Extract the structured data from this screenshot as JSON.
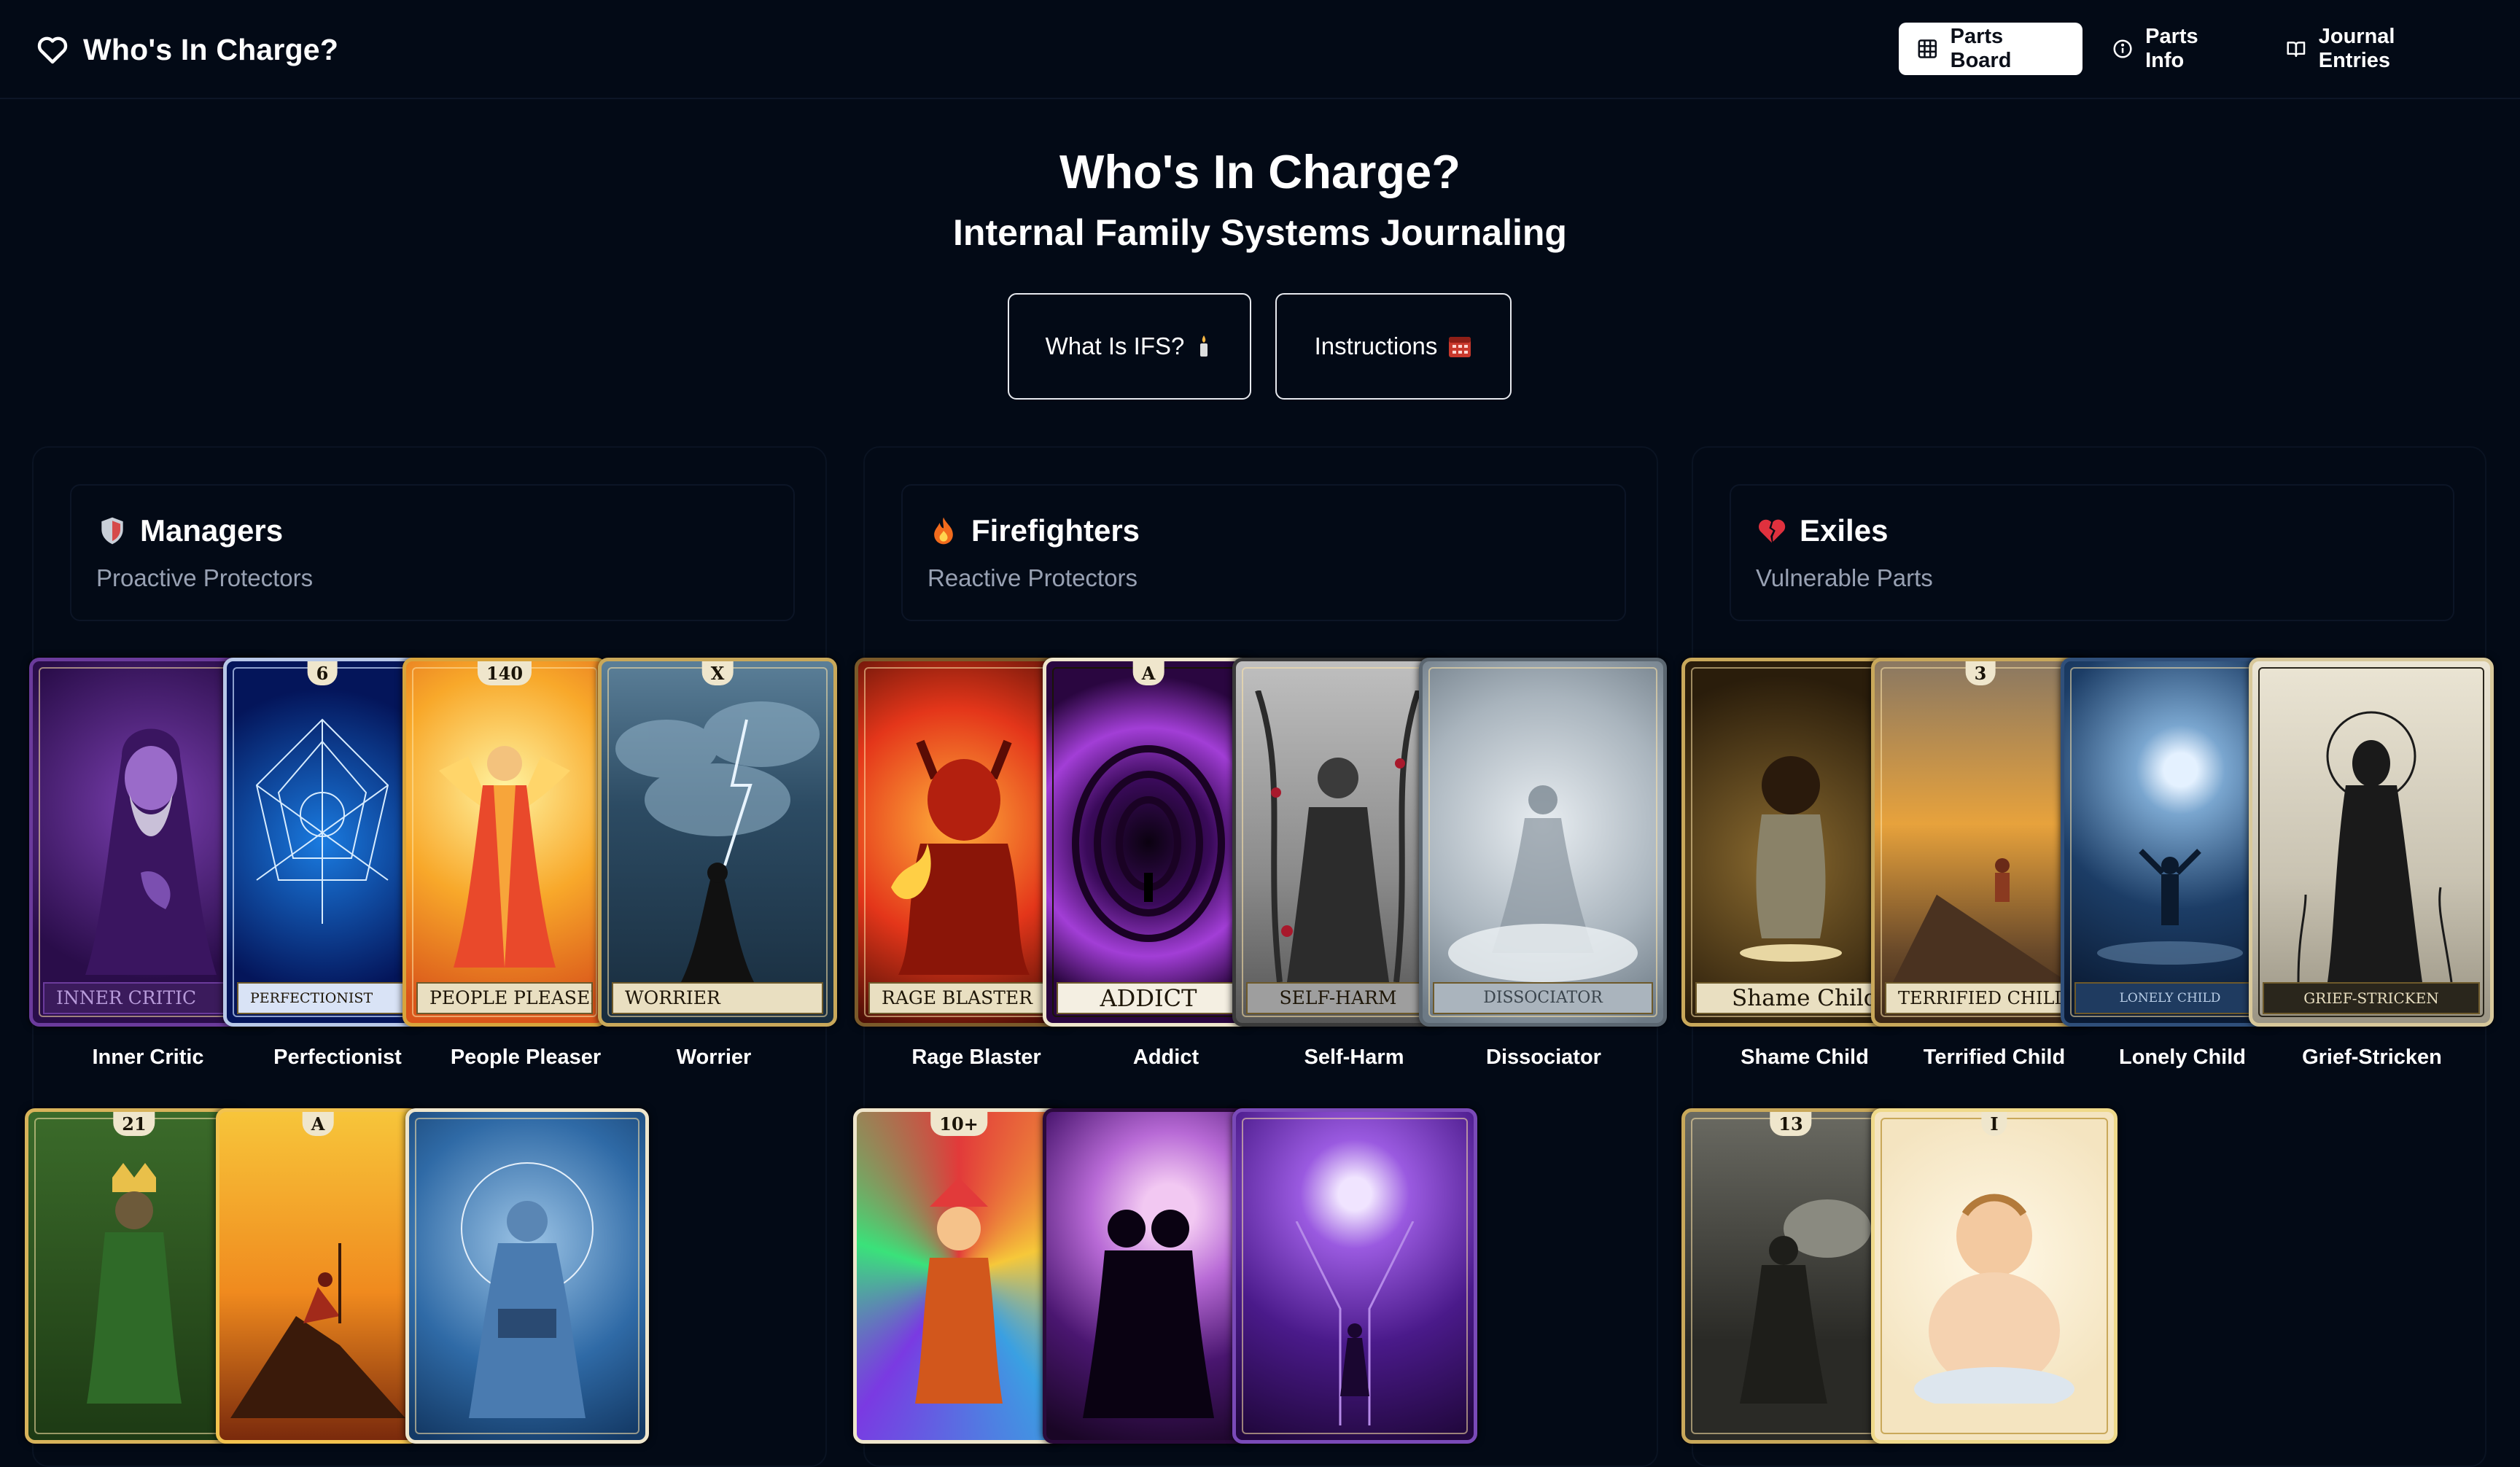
{
  "app": {
    "title": "Who's In Charge?"
  },
  "nav": {
    "parts_board": "Parts Board",
    "parts_info": "Parts Info",
    "journal_entries": "Journal Entries"
  },
  "hero": {
    "title": "Who's In Charge?",
    "subtitle": "Internal Family Systems Journaling",
    "what_is_ifs": "What Is IFS?",
    "instructions": "Instructions"
  },
  "columns": [
    {
      "emoji": "shield",
      "title": "Managers",
      "subtitle": "Proactive Protectors",
      "cards": [
        {
          "label": "Inner Critic",
          "plate": "INNER CRITIC"
        },
        {
          "label": "Perfectionist",
          "plate": "PERFECTIONIST",
          "number": "6"
        },
        {
          "label": "People Pleaser",
          "plate": "PEOPLE PLEASER",
          "number": "140"
        },
        {
          "label": "Worrier",
          "plate": "WORRIER",
          "number": "X"
        }
      ],
      "row2": [
        {
          "number": "21"
        },
        {
          "number": "A"
        },
        {
          "number": ""
        }
      ]
    },
    {
      "emoji": "fire",
      "title": "Firefighters",
      "subtitle": "Reactive Protectors",
      "cards": [
        {
          "label": "Rage Blaster",
          "plate": "RAGE BLASTER"
        },
        {
          "label": "Addict",
          "plate": "ADDICT",
          "number": "A"
        },
        {
          "label": "Self-Harm",
          "plate": "SELF-HARM"
        },
        {
          "label": "Dissociator",
          "plate": "DISSOCIATOR"
        }
      ],
      "row2": [
        {
          "number": "10+"
        },
        {
          "number": ""
        },
        {
          "number": ""
        }
      ]
    },
    {
      "emoji": "broken-heart",
      "title": "Exiles",
      "subtitle": "Vulnerable Parts",
      "cards": [
        {
          "label": "Shame Child",
          "plate": "Shame Child"
        },
        {
          "label": "Terrified Child",
          "plate": "TERRIFIED CHILD",
          "number": "3"
        },
        {
          "label": "Lonely Child",
          "plate": "LONELY CHILD"
        },
        {
          "label": "Grief-Stricken",
          "plate": "GRIEF-STRICKEN"
        }
      ],
      "row2": [
        {
          "number": "13"
        },
        {
          "number": "I"
        }
      ]
    }
  ],
  "colors": {
    "background": "#030a16",
    "active_button_bg": "#ffffff",
    "muted_text": "#98a1b3"
  }
}
